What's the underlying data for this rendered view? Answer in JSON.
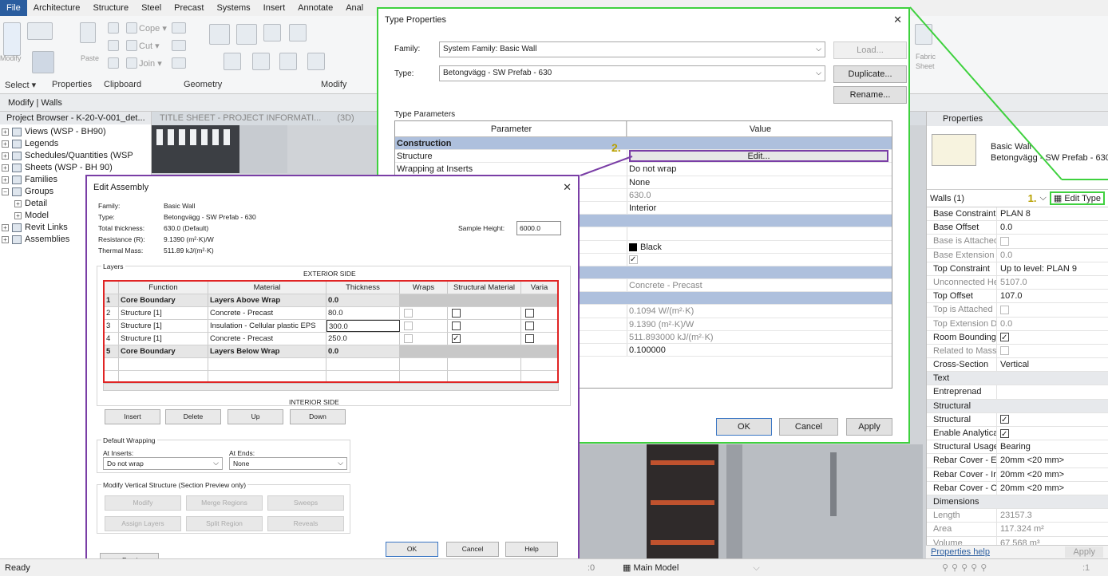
{
  "menubar": [
    "File",
    "Architecture",
    "Structure",
    "Steel",
    "Precast",
    "Systems",
    "Insert",
    "Annotate",
    "Anal"
  ],
  "ribbon": {
    "modify_label": "Modify",
    "select_label": "Select ▾",
    "properties_label": "Properties",
    "clipboard_label": "Clipboard",
    "geometry_label": "Geometry",
    "modify_panel_label": "Modify",
    "paste_label": "Paste",
    "cope_label": "Cope ▾",
    "cut_label": "Cut ▾",
    "join_label": "Join ▾",
    "fabric_label": "Fabric",
    "sheet_label": "Sheet"
  },
  "optionbar": "Modify | Walls",
  "browser": {
    "title": "Project Browser - K-20-V-001_det...",
    "items": [
      {
        "label": "Views (WSP - BH90)",
        "exp": "+"
      },
      {
        "label": "Legends",
        "exp": "+"
      },
      {
        "label": "Schedules/Quantities (WSP",
        "exp": "+"
      },
      {
        "label": "Sheets (WSP - BH 90)",
        "exp": "+"
      },
      {
        "label": "Families",
        "exp": "+"
      },
      {
        "label": "Groups",
        "exp": "−"
      },
      {
        "label": "Detail",
        "exp": "+",
        "indent": true
      },
      {
        "label": "Model",
        "exp": "+",
        "indent": true
      },
      {
        "label": "Revit Links",
        "exp": "+"
      },
      {
        "label": "Assemblies",
        "exp": "+"
      }
    ]
  },
  "viewtabs": [
    "TITLE SHEET - PROJECT INFORMATI...",
    "(3D)"
  ],
  "type_properties": {
    "title": "Type Properties",
    "family_label": "Family:",
    "family_value": "System Family: Basic Wall",
    "type_label": "Type:",
    "type_value": "Betongvägg - SW Prefab - 630",
    "load_button": "Load...",
    "duplicate_button": "Duplicate...",
    "rename_button": "Rename...",
    "type_parameters_label": "Type Parameters",
    "col_parameter": "Parameter",
    "col_value": "Value",
    "rows": [
      {
        "p": "Construction",
        "v": "",
        "sec": true
      },
      {
        "p": "Structure",
        "v": "Edit...",
        "btn": true
      },
      {
        "p": "Wrapping at Inserts",
        "v": "Do not wrap"
      },
      {
        "p": "",
        "v": "None"
      },
      {
        "p": "",
        "v": "630.0",
        "grey": true
      },
      {
        "p": "",
        "v": "Interior"
      },
      {
        "p": "",
        "v": "",
        "sec": true
      },
      {
        "p": "",
        "v": ""
      },
      {
        "p": "",
        "v": "Black",
        "swatch": true
      },
      {
        "p": "",
        "v": "",
        "check": true
      },
      {
        "p": "",
        "v": "",
        "sec": true
      },
      {
        "p": "",
        "v": "Concrete - Precast",
        "grey": true
      },
      {
        "p": "",
        "v": "",
        "sec": true
      },
      {
        "p": "",
        "v": "0.1094 W/(m²·K)",
        "grey": true
      },
      {
        "p": "",
        "v": "9.1390 (m²·K)/W",
        "grey": true
      },
      {
        "p": "",
        "v": "511.893000 kJ/(m²·K)",
        "grey": true
      },
      {
        "p": "",
        "v": "0.100000"
      }
    ],
    "ok_button": "OK",
    "cancel_button": "Cancel",
    "apply_button": "Apply",
    "marker": "2."
  },
  "edit_assembly": {
    "title": "Edit Assembly",
    "info": [
      {
        "k": "Family:",
        "v": "Basic Wall"
      },
      {
        "k": "Type:",
        "v": "Betongvägg - SW Prefab - 630"
      },
      {
        "k": "Total thickness:",
        "v": "630.0 (Default)"
      },
      {
        "k": "Resistance (R):",
        "v": "9.1390 (m²·K)/W"
      },
      {
        "k": "Thermal Mass:",
        "v": "511.89 kJ/(m²·K)"
      }
    ],
    "sample_height_label": "Sample Height:",
    "sample_height_value": "6000.0",
    "layers_label": "Layers",
    "exterior_label": "EXTERIOR SIDE",
    "interior_label": "INTERIOR SIDE",
    "columns": [
      "",
      "Function",
      "Material",
      "Thickness",
      "Wraps",
      "Structural Material",
      "Varia"
    ],
    "layers": [
      {
        "n": "1",
        "f": "Core Boundary",
        "m": "Layers Above Wrap",
        "t": "0.0",
        "bold": true
      },
      {
        "n": "2",
        "f": "Structure [1]",
        "m": "Concrete - Precast",
        "t": "80.0",
        "sm": false
      },
      {
        "n": "3",
        "f": "Structure [1]",
        "m": "Insulation - Cellular plastic EPS",
        "t": "300.0",
        "sm": false
      },
      {
        "n": "4",
        "f": "Structure [1]",
        "m": "Concrete - Precast",
        "t": "250.0",
        "sm": true
      },
      {
        "n": "5",
        "f": "Core Boundary",
        "m": "Layers Below Wrap",
        "t": "0.0",
        "bold": true
      }
    ],
    "insert_button": "Insert",
    "delete_button": "Delete",
    "up_button": "Up",
    "down_button": "Down",
    "default_wrapping_label": "Default Wrapping",
    "at_inserts_label": "At Inserts:",
    "at_inserts_value": "Do not wrap",
    "at_ends_label": "At Ends:",
    "at_ends_value": "None",
    "modify_vertical_label": "Modify Vertical Structure (Section Preview only)",
    "modify_button": "Modify",
    "merge_button": "Merge Regions",
    "sweeps_button": "Sweeps",
    "assign_button": "Assign Layers",
    "split_button": "Split Region",
    "reveals_button": "Reveals",
    "preview_button": "<< Preview",
    "ok_button": "OK",
    "cancel_button": "Cancel",
    "help_button": "Help"
  },
  "properties": {
    "title": "Properties",
    "family": "Basic Wall",
    "type": "Betongvägg - SW Prefab - 630",
    "selector": "Walls (1)",
    "edit_type": "Edit Type",
    "marker": "1.",
    "rows": [
      {
        "n": "Base Constraint",
        "v": "PLAN 8"
      },
      {
        "n": "Base Offset",
        "v": "0.0"
      },
      {
        "n": "Base is Attached",
        "v": "",
        "cb": "dis",
        "grey": true
      },
      {
        "n": "Base Extension Di...",
        "v": "0.0",
        "grey": true
      },
      {
        "n": "Top Constraint",
        "v": "Up to level: PLAN 9"
      },
      {
        "n": "Unconnected Hei...",
        "v": "5107.0",
        "grey": true
      },
      {
        "n": "Top Offset",
        "v": "107.0"
      },
      {
        "n": "Top is Attached",
        "v": "",
        "cb": "dis",
        "grey": true
      },
      {
        "n": "Top Extension Dis...",
        "v": "0.0",
        "grey": true
      },
      {
        "n": "Room Bounding",
        "v": "",
        "cb": "checked"
      },
      {
        "n": "Related to Mass",
        "v": "",
        "cb": "dis",
        "grey": true
      },
      {
        "n": "Cross-Section",
        "v": "Vertical"
      },
      {
        "n": "Text",
        "v": "",
        "section": true
      },
      {
        "n": "Entreprenad",
        "v": ""
      },
      {
        "n": "Structural",
        "v": "",
        "section": true
      },
      {
        "n": "Structural",
        "v": "",
        "cb": "checked"
      },
      {
        "n": "Enable Analytical ...",
        "v": "",
        "cb": "checked"
      },
      {
        "n": "Structural Usage",
        "v": "Bearing"
      },
      {
        "n": "Rebar Cover - Ext...",
        "v": "20mm <20 mm>"
      },
      {
        "n": "Rebar Cover - Inte...",
        "v": "20mm <20 mm>"
      },
      {
        "n": "Rebar Cover - Oth...",
        "v": "20mm <20 mm>"
      },
      {
        "n": "Dimensions",
        "v": "",
        "section": true
      },
      {
        "n": "Length",
        "v": "23157.3",
        "grey": true
      },
      {
        "n": "Area",
        "v": "117.324 m²",
        "grey": true
      },
      {
        "n": "Volume",
        "v": "67.568 m³",
        "grey": true
      }
    ],
    "help_link": "Properties help",
    "apply_button": "Apply"
  },
  "status": {
    "ready": "Ready",
    "model": "Main Model",
    "zoom": ":0",
    "filter": ":1"
  }
}
